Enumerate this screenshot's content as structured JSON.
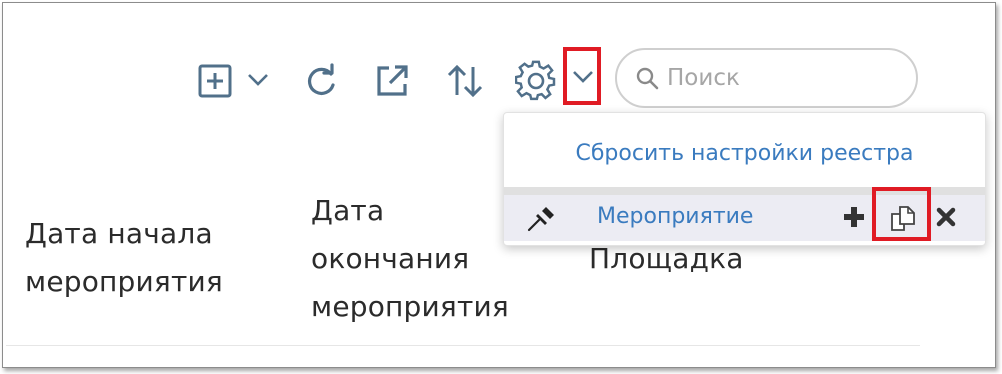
{
  "toolbar": {
    "add_icon": "plus-square-icon",
    "add_dropdown_icon": "chevron-down-icon",
    "refresh_icon": "refresh-icon",
    "export_icon": "external-link-icon",
    "sort_icon": "sort-arrows-icon",
    "settings_icon": "gear-icon",
    "settings_dropdown_icon": "chevron-down-icon",
    "icon_color": "#51708a",
    "highlight_color": "#e01b24"
  },
  "search": {
    "placeholder": "Поиск",
    "value": "",
    "icon": "search-icon"
  },
  "columns": {
    "start_date_line1": "Дата начала",
    "start_date_line2": "мероприятия",
    "end_date_line1": "Дата",
    "end_date_line2": "окончания",
    "end_date_line3": "мероприятия",
    "venue": "Площадка"
  },
  "settings_menu": {
    "reset_label": "Сбросить настройки реестра",
    "preset": {
      "name": "Мероприятие",
      "pin_icon": "pin-icon",
      "add_icon": "plus-icon",
      "copy_icon": "copy-icon",
      "delete_icon": "close-icon"
    },
    "link_color": "#3a7bbf"
  }
}
